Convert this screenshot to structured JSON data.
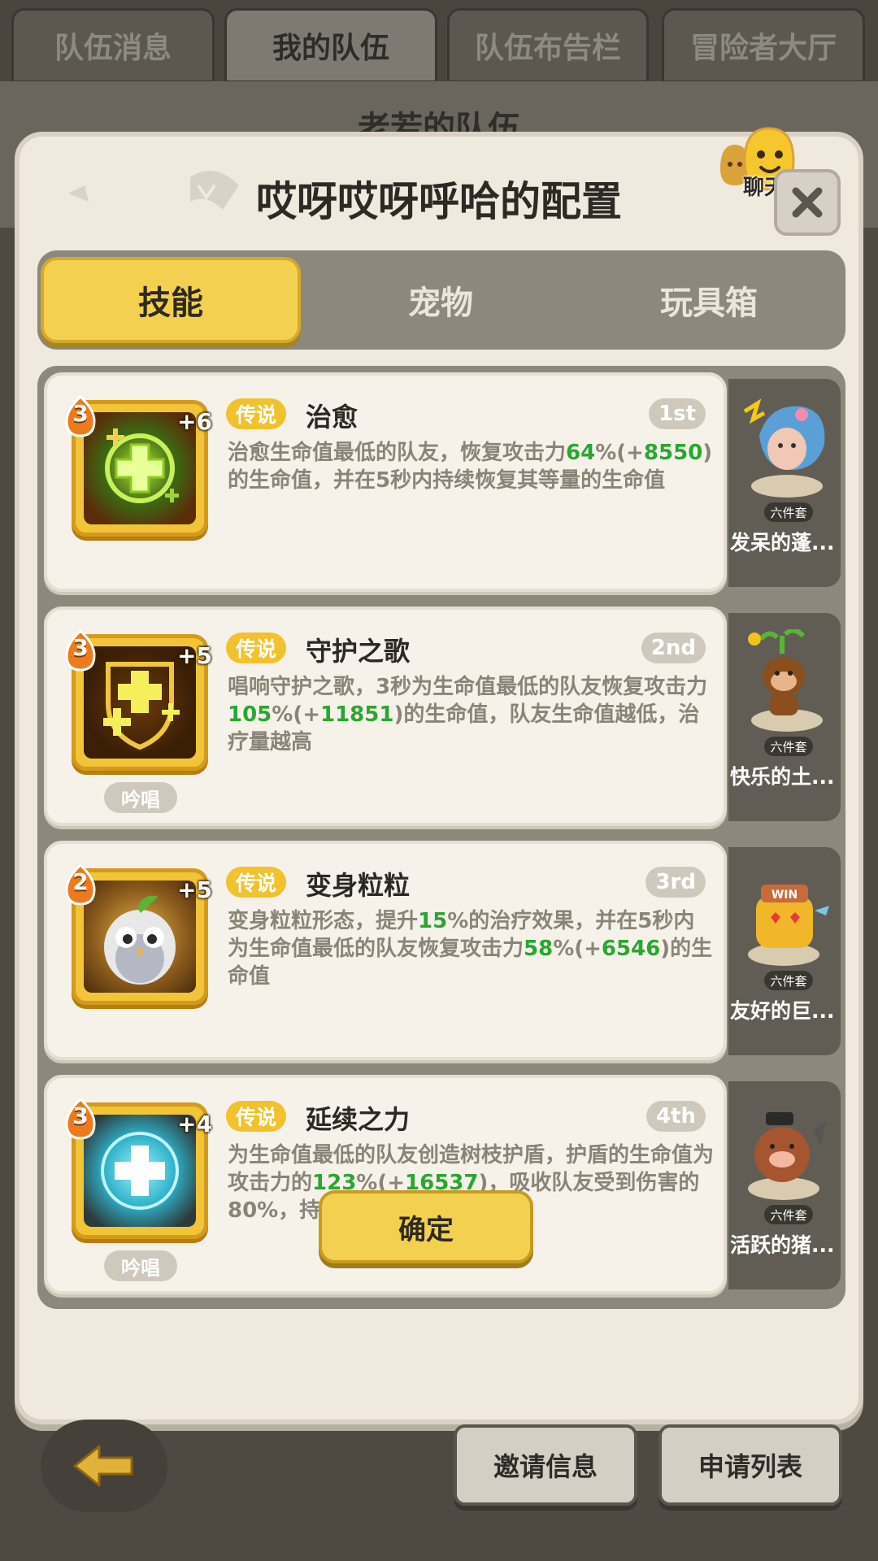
{
  "top_tabs": [
    {
      "label": "队伍消息",
      "active": false
    },
    {
      "label": "我的队伍",
      "active": true
    },
    {
      "label": "队伍布告栏",
      "active": false
    },
    {
      "label": "冒险者大厅",
      "active": false
    }
  ],
  "background_title": "老若的队伍",
  "modal": {
    "title": "哎呀哎呀呼哈的配置",
    "chat_label": "聊天",
    "tabs": [
      {
        "label": "技能",
        "active": true
      },
      {
        "label": "宠物",
        "active": false
      },
      {
        "label": "玩具箱",
        "active": false
      }
    ],
    "skills": [
      {
        "level": "3",
        "plus": "+6",
        "rarity": "传说",
        "name": "治愈",
        "rank": "1st",
        "desc_parts": [
          {
            "t": "治愈生命值最低的队友，恢复攻击力"
          },
          {
            "t": "64",
            "hl": true
          },
          {
            "t": "%(+"
          },
          {
            "t": "8550",
            "hl": true
          },
          {
            "t": ")的生命值，并在5秒内持续恢复其等量的生命值"
          }
        ],
        "chant": "",
        "pet_name": "发呆的蓬...",
        "pet_badge": "六件套",
        "icon": "heal-cross-icon"
      },
      {
        "level": "3",
        "plus": "+5",
        "rarity": "传说",
        "name": "守护之歌",
        "rank": "2nd",
        "desc_parts": [
          {
            "t": "唱响守护之歌，3秒为生命值最低的队友恢复攻击力"
          },
          {
            "t": "105",
            "hl": true
          },
          {
            "t": "%(+"
          },
          {
            "t": "11851",
            "hl": true
          },
          {
            "t": ")的生命值，队友生命值越低，治疗量越高"
          }
        ],
        "chant": "吟唱",
        "pet_name": "快乐的土...",
        "pet_badge": "六件套",
        "icon": "guardian-song-icon"
      },
      {
        "level": "2",
        "plus": "+5",
        "rarity": "传说",
        "name": "变身粒粒",
        "rank": "3rd",
        "desc_parts": [
          {
            "t": "变身粒粒形态，提升"
          },
          {
            "t": "15",
            "hl": true
          },
          {
            "t": "%的治疗效果，并在5秒内为生命值最低的队友恢复攻击力"
          },
          {
            "t": "58",
            "hl": true
          },
          {
            "t": "%(+"
          },
          {
            "t": "6546",
            "hl": true
          },
          {
            "t": ")的生命值"
          }
        ],
        "chant": "",
        "pet_name": "友好的巨...",
        "pet_badge": "六件套",
        "icon": "owl-transform-icon"
      },
      {
        "level": "3",
        "plus": "+4",
        "rarity": "传说",
        "name": "延续之力",
        "rank": "4th",
        "desc_parts": [
          {
            "t": "为生命值最低的队友创造树枝护盾，护盾的生命值为攻击力的"
          },
          {
            "t": "123",
            "hl": true
          },
          {
            "t": "%(+"
          },
          {
            "t": "16537",
            "hl": true
          },
          {
            "t": ")，吸收队友受到伤害的80%，持续10秒"
          }
        ],
        "chant": "吟唱",
        "pet_name": "活跃的猪...",
        "pet_badge": "六件套",
        "icon": "shield-cross-icon"
      }
    ],
    "confirm_label": "确定"
  },
  "bottom": {
    "invite_label": "邀请信息",
    "apply_label": "申请列表"
  },
  "colors": {
    "accent_yellow": "#f4d051",
    "highlight_green": "#2aa631",
    "panel_bg": "#efe9de"
  }
}
